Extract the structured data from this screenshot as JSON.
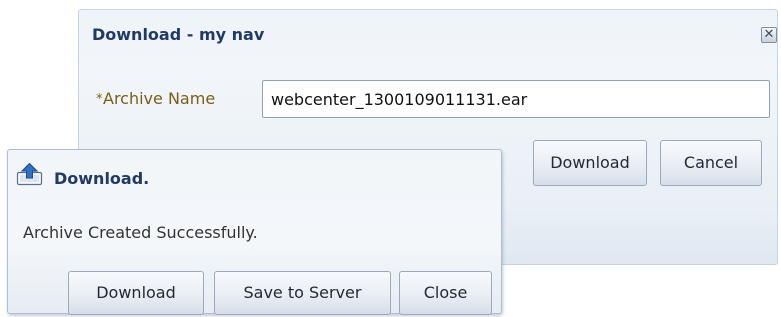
{
  "back_dialog": {
    "title": "Download - my nav",
    "close_glyph": "✕",
    "form": {
      "required_mark": "*",
      "archive_name_label": "Archive Name",
      "archive_name_value": "webcenter_1300109011131.ear"
    },
    "buttons": {
      "download_label": "Download",
      "cancel_label": "Cancel"
    }
  },
  "popup": {
    "icon": "upload-arrow-icon",
    "title": "Download.",
    "message": "Archive Created Successfully.",
    "buttons": {
      "download_label": "Download",
      "save_to_server_label": "Save to Server",
      "close_label": "Close"
    }
  },
  "colors": {
    "title_text": "#213a63",
    "label_text": "#7a5d1a",
    "button_border": "#9aa9bd",
    "dialog_background": "#eef3f9"
  }
}
